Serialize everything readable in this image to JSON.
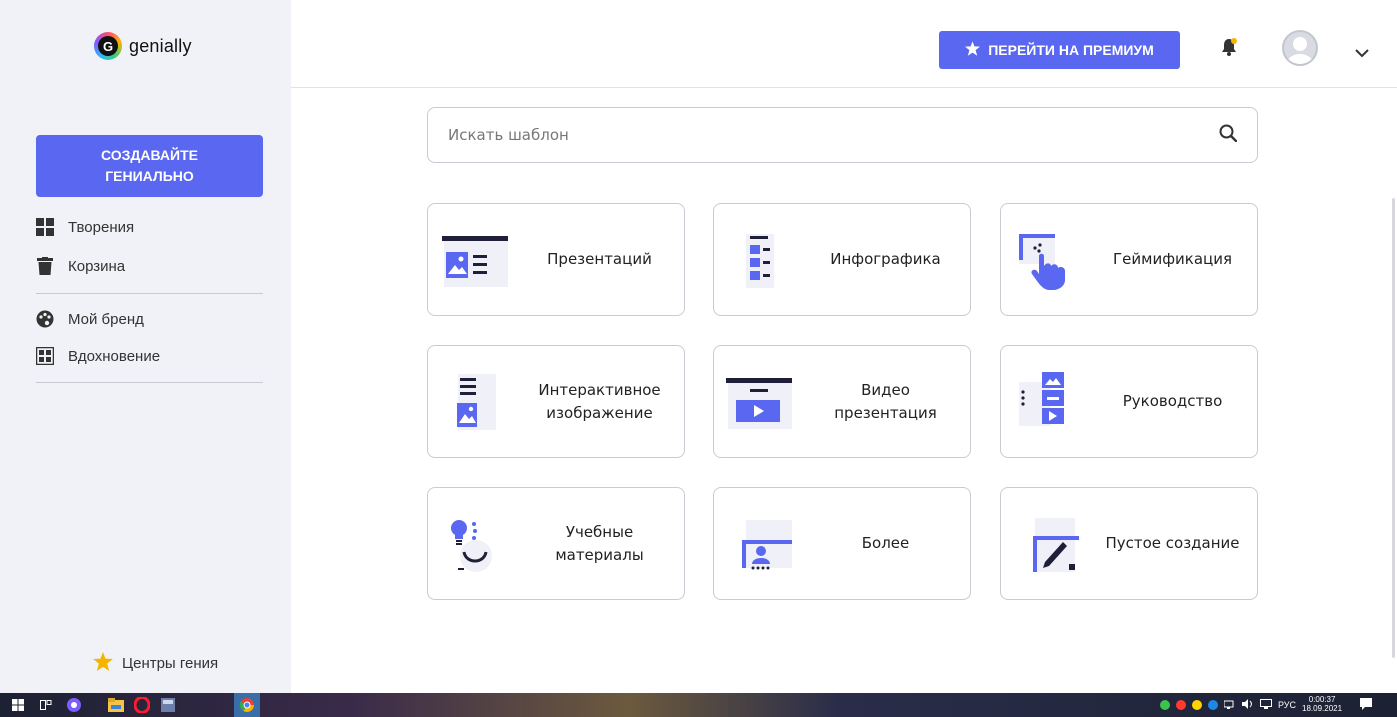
{
  "app": {
    "logo_text": "genially"
  },
  "sidebar": {
    "create_button": "СОЗДАВАЙТЕ ГЕНИАЛЬНО",
    "items": [
      {
        "label": "Творения",
        "icon": "grid-icon"
      },
      {
        "label": "Корзина",
        "icon": "trash-icon"
      },
      {
        "label": "Мой бренд",
        "icon": "palette-icon"
      },
      {
        "label": "Вдохновение",
        "icon": "inspiration-icon"
      }
    ],
    "footer_link": "Центры гения"
  },
  "header": {
    "premium_button": "ПЕРЕЙТИ НА ПРЕМИУМ"
  },
  "search": {
    "placeholder": "Искать шаблон"
  },
  "cards": [
    {
      "label": "Презентаций",
      "icon": "presentation-icon"
    },
    {
      "label": "Инфографика",
      "icon": "infographic-icon"
    },
    {
      "label": "Геймификация",
      "icon": "gamification-icon"
    },
    {
      "label": "Интерактивное изображение",
      "icon": "interactive-image-icon"
    },
    {
      "label": "Видео презентация",
      "icon": "video-presentation-icon"
    },
    {
      "label": "Руководство",
      "icon": "guide-icon"
    },
    {
      "label": "Учебные материалы",
      "icon": "training-materials-icon"
    },
    {
      "label": "Более",
      "icon": "more-icon"
    },
    {
      "label": "Пустое создание",
      "icon": "blank-creation-icon"
    }
  ],
  "taskbar": {
    "language": "РУС",
    "time": "0:00:37",
    "date": "18.09.2021"
  },
  "colors": {
    "accent": "#5a67f0",
    "sidebar_bg": "#f1f2f7",
    "icon_dark": "#1f1f3a"
  }
}
